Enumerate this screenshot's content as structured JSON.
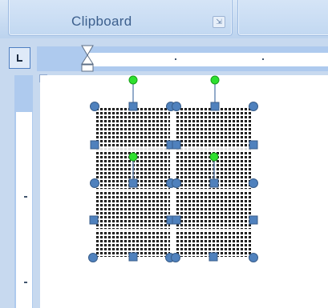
{
  "ribbon": {
    "group_label": "Clipboard",
    "launcher_icon": "dialog-launcher-icon"
  },
  "rulers": {
    "tab_selector_icon": "left-tab-icon",
    "indent_marker_icon": "hourglass-indent-icon"
  },
  "colors": {
    "handle_blue": "#4f81bd",
    "rotate_green": "#2ee02e",
    "ruler_margin": "#aecaee",
    "ribbon_text": "#3c5f8d"
  }
}
